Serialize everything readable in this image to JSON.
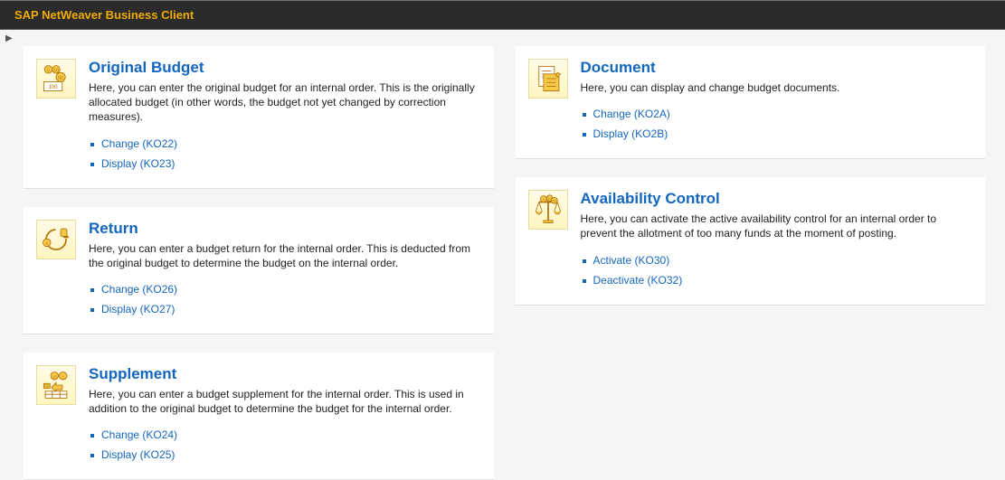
{
  "app_title": "SAP NetWeaver Business Client",
  "columns": [
    [
      {
        "id": "original-budget",
        "icon": "money-icon",
        "title": "Original Budget",
        "desc": "Here, you can enter the original budget for an internal order. This is the originally allocated budget (in other words, the budget not yet changed by correction measures).",
        "links": [
          {
            "label": "Change (KO22)"
          },
          {
            "label": "Display (KO23)"
          }
        ]
      },
      {
        "id": "return",
        "icon": "return-icon",
        "title": "Return",
        "desc": "Here, you can enter a budget return for the internal order. This is deducted from the original budget to determine the budget on the internal order.",
        "links": [
          {
            "label": "Change (KO26)"
          },
          {
            "label": "Display (KO27)"
          }
        ]
      },
      {
        "id": "supplement",
        "icon": "supplement-icon",
        "title": "Supplement",
        "desc": "Here, you can enter a budget supplement for the internal order. This is used in addition to the original budget to determine the budget for the internal order.",
        "links": [
          {
            "label": "Change (KO24)"
          },
          {
            "label": "Display (KO25)"
          }
        ]
      }
    ],
    [
      {
        "id": "document",
        "icon": "document-icon",
        "title": "Document",
        "desc": "Here, you can display and change budget documents.",
        "links": [
          {
            "label": "Change (KO2A)"
          },
          {
            "label": "Display (KO2B)"
          }
        ]
      },
      {
        "id": "availability-control",
        "icon": "scale-icon",
        "title": "Availability Control",
        "desc": "Here, you can activate the active availability control for an internal order to prevent the allotment of too many funds at the moment of posting.",
        "links": [
          {
            "label": "Activate (KO30)"
          },
          {
            "label": "Deactivate (KO32)"
          }
        ]
      }
    ]
  ]
}
